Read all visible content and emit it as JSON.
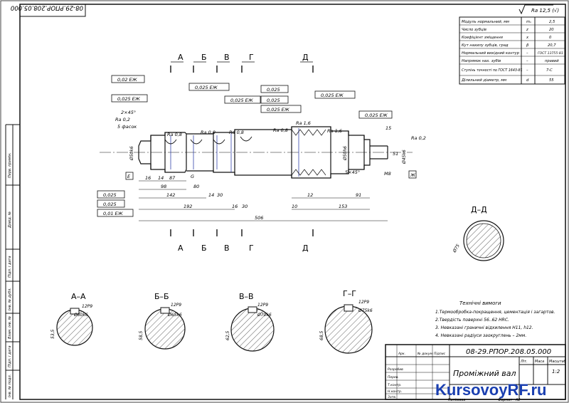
{
  "stamp_code_rotated": "08-29.РПОР.208.05.000",
  "drawing_number": "08-29.РПОР.208.05.000",
  "drawing_title": "Проміжний вал",
  "sheet_format": "А2",
  "scale": "1:2",
  "surface_roughness_general": "Ra 12,5 (√)",
  "gear_params": {
    "rows": [
      {
        "label": "Модуль нормальний, мм",
        "sym": "mₙ",
        "val": "2,5"
      },
      {
        "label": "Число зубців",
        "sym": "z",
        "val": "20"
      },
      {
        "label": "Коефіцієнт зміщення",
        "sym": "x",
        "val": "0"
      },
      {
        "label": "Кут нахилу зубців, град",
        "sym": "β",
        "val": "20,7"
      },
      {
        "label": "Нормальний вихідний контур",
        "sym": "–",
        "val": "ГОСТ 13755-81"
      },
      {
        "label": "Напрямок нах. зубів",
        "sym": "–",
        "val": "правий"
      },
      {
        "label": "Ступінь точності по ГОСТ 1643-81",
        "sym": "–",
        "val": "7-С"
      },
      {
        "label": "Ділильний діаметр, мм",
        "sym": "d",
        "val": "55"
      }
    ]
  },
  "section_marks": [
    "А",
    "Б",
    "В",
    "Г",
    "Д"
  ],
  "tolerances": {
    "t1": "0,02  ЕЖ",
    "t2": "0,025  ЕЖ",
    "t3": "0,025  ЕЖ",
    "t4": "0,025",
    "t5": "0,025",
    "t6": "0,025  ЕЖ",
    "t7": "0,025  ЕЖ",
    "t8": "0,025  ЕЖ",
    "t9": "0,025",
    "t10": "0,025",
    "t11": "0,01  ЕЖ"
  },
  "roughness": {
    "r1": "Ra 0,2",
    "r2": "Ra 0,8",
    "r3": "Ra 0,8",
    "r4": "Ra 0,8",
    "r5": "Ra 0,8",
    "r6": "Ra 1,6",
    "r7": "Ra 1,6",
    "r8": "Ra 0,2"
  },
  "notes_left": {
    "chamfer": "2×45°",
    "chamfers_count": "5 фасок",
    "datum_e": "Е",
    "datum_g": "G",
    "datum_zh": "Ж"
  },
  "dims": {
    "d16": "16",
    "d14": "14",
    "d87": "87",
    "d98": "98",
    "d80": "80",
    "d14b": "14",
    "d30": "30",
    "d142": "142",
    "d192": "192",
    "d16b": "16",
    "d30b": "30",
    "d506": "506",
    "d10": "10",
    "d12": "12",
    "d153": "153",
    "d91": "91",
    "d15": "15",
    "d5x45": "5×45°",
    "dm6": "М8",
    "d_left_dia": "Ø50k6",
    "d_right_dia": "Ø60m6",
    "d_right2": "Ø45k6",
    "d_51": "51",
    "d_gear": "Ø50h6"
  },
  "sections": {
    "aa": {
      "title": "А–А",
      "keyway": "12Р9",
      "dia": "Ø60k6",
      "depth": "53,5"
    },
    "bb": {
      "title": "Б–Б",
      "keyway": "12Р9",
      "dia": "Ø65k6",
      "depth": "58,5"
    },
    "vv": {
      "title": "В–В",
      "keyway": "12Р9",
      "dia": "Ø70k6",
      "depth": "62,5"
    },
    "gg": {
      "title": "Г–Г",
      "keyway": "12Р9",
      "dia": "Ø75k6",
      "depth": "68,5"
    },
    "dd": {
      "title": "Д–Д",
      "dia": "Ø75"
    }
  },
  "tech_req": {
    "title": "Технічні вимоги",
    "lines": [
      "1.Термообробка-покращення, цементація і загартов.",
      "2.Твердість поверхні 56..62 НRС.",
      "3. Невказані граничні відхилення  Н11, h12.",
      "4. Невказані радіуси заокруглень – 2мм."
    ]
  },
  "title_block": {
    "change": "Змін.",
    "sheet": "Арк.",
    "doc_no": "№ докум.",
    "sign": "Підпис",
    "date": "Дата",
    "developed": "Розробив",
    "checked": "Перев.",
    "t_control": "Т.контр.",
    "n_control": "Н.контр.",
    "approved": "Затв.",
    "lit": "Літ.",
    "mass": "Маса",
    "scale_lbl": "Масштаб",
    "sheet_of": "Аркуш",
    "sheets": "Аркушів 1",
    "copied": "Копіював",
    "format_lbl": "Формат"
  },
  "left_strip": [
    "Перв. примін.",
    "Довід. №",
    "Підп. і дата",
    "Інв. № дубл.",
    "Взам. інв. №",
    "Підп. і дата",
    "Інв. № подл."
  ],
  "watermark": "KursovoyRF.ru"
}
